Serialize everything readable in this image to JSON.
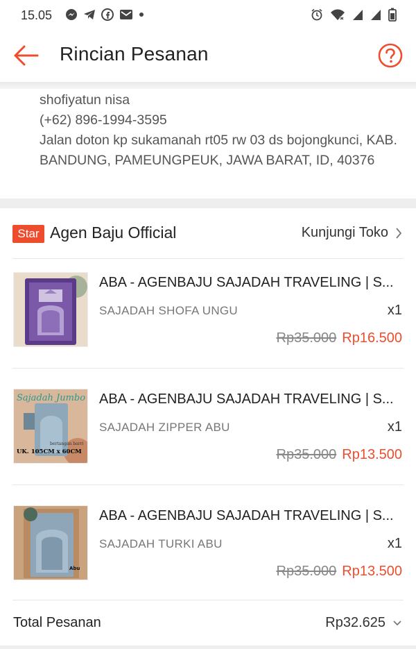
{
  "status_bar": {
    "time": "15.05",
    "notification_icons": [
      "messenger-icon",
      "telegram-icon",
      "facebook-icon",
      "gmail-icon",
      "dot-icon"
    ],
    "system_icons": [
      "alarm-icon",
      "wifi-icon",
      "signal-icon",
      "signal-icon",
      "battery-icon"
    ]
  },
  "header": {
    "title": "Rincian Pesanan",
    "back_icon": "arrow-left-icon",
    "help_icon": "question-circle-icon",
    "accent_color": "#ee4d2d"
  },
  "address": {
    "name": "shofiyatun nisa",
    "phone": "(+62) 896-1994-3595",
    "line": "Jalan doton  kp sukamanah rt05 rw 03 ds bojongkunci, KAB. BANDUNG, PAMEUNGPEUK, JAWA BARAT, ID, 40376"
  },
  "shop": {
    "badge": "Star",
    "name": "Agen Baju Official",
    "visit_label": "Kunjungi Toko"
  },
  "items": [
    {
      "title": "ABA - AGENBAJU SAJADAH TRAVELING | S...",
      "variant": "SAJADAH SHOFA UNGU",
      "qty": "x1",
      "price_old": "Rp35.000",
      "price_new": "Rp16.500"
    },
    {
      "title": "ABA - AGENBAJU SAJADAH TRAVELING | S...",
      "variant": "SAJADAH ZIPPER ABU",
      "qty": "x1",
      "price_old": "Rp35.000",
      "price_new": "Rp13.500",
      "image_text": {
        "banner": "Sajadah Jumbo",
        "note": "bertangan barri",
        "size": "UK. 105CM x 60CM"
      }
    },
    {
      "title": "ABA - AGENBAJU SAJADAH TRAVELING | S...",
      "variant": "SAJADAH TURKI ABU",
      "qty": "x1",
      "price_old": "Rp35.000",
      "price_new": "Rp13.500",
      "image_text": {
        "tag": "Abu"
      }
    }
  ],
  "total": {
    "label": "Total Pesanan",
    "value": "Rp32.625"
  }
}
